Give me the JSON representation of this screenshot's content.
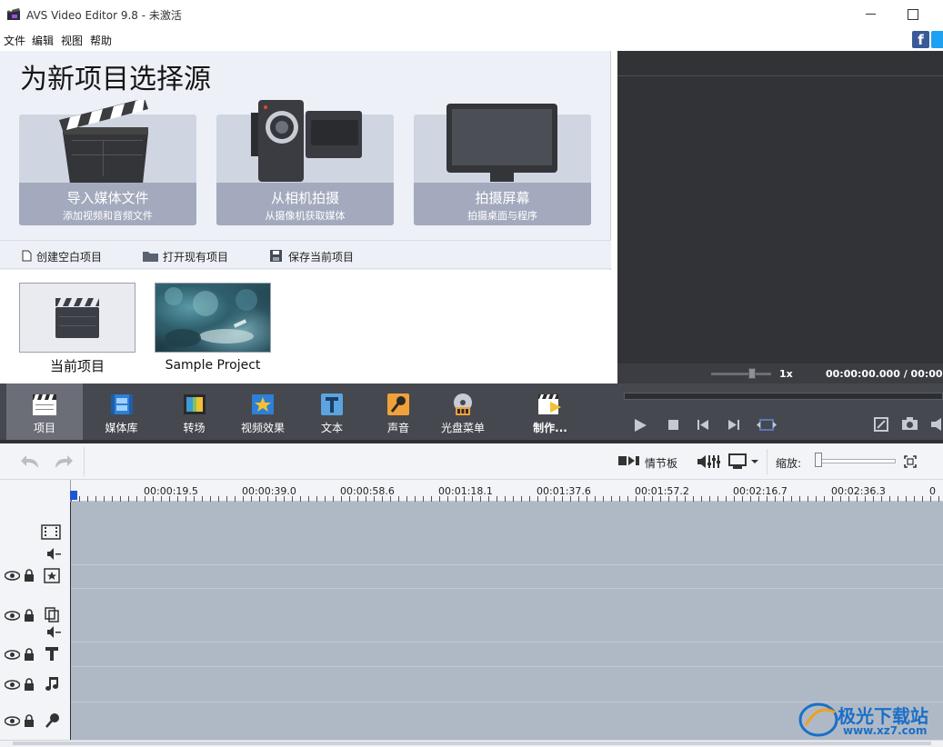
{
  "window": {
    "title": "AVS Video Editor 9.8 - 未激活"
  },
  "menu": {
    "items": [
      "文件",
      "编辑",
      "视图",
      "帮助"
    ]
  },
  "social": {
    "facebook_glyph": "f"
  },
  "source": {
    "title": "为新项目选择源",
    "cards": [
      {
        "title": "导入媒体文件",
        "subtitle": "添加视频和音频文件",
        "icon": "clapperboard-icon"
      },
      {
        "title": "从相机拍摄",
        "subtitle": "从摄像机获取媒体",
        "icon": "camcorder-icon"
      },
      {
        "title": "拍摄屏幕",
        "subtitle": "拍摄桌面与程序",
        "icon": "monitor-icon"
      }
    ]
  },
  "project_actions": {
    "create": "创建空白项目",
    "open": "打开现有项目",
    "save": "保存当前项目"
  },
  "recent": {
    "current": "当前项目",
    "sample": "Sample Project"
  },
  "preview": {
    "speed": "1x",
    "timecode": "00:00:00.000 / 00:00:0"
  },
  "toolbar": {
    "items": [
      {
        "label": "项目",
        "icon": "project-icon",
        "active": true
      },
      {
        "label": "媒体库",
        "icon": "media-library-icon"
      },
      {
        "label": "转场",
        "icon": "transitions-icon"
      },
      {
        "label": "视频效果",
        "icon": "video-effects-icon"
      },
      {
        "label": "文本",
        "icon": "text-icon"
      },
      {
        "label": "声音",
        "icon": "microphone-icon"
      },
      {
        "label": "光盘菜单",
        "icon": "disc-menu-icon"
      },
      {
        "label": "制作...",
        "icon": "produce-icon"
      }
    ]
  },
  "timeline_toolbar": {
    "storyboard": "情节板",
    "zoom": "缩放:"
  },
  "ruler": {
    "labels": [
      "00:00:19.5",
      "00:00:39.0",
      "00:00:58.6",
      "00:01:18.1",
      "00:01:37.6",
      "00:01:57.2",
      "00:02:16.7",
      "00:02:36.3",
      "0"
    ]
  },
  "colors": {
    "toolbar_bg": "#46484f",
    "timeline_bg": "#afb9c6",
    "preview_bg": "#323336",
    "accent_blue": "#1e56d6"
  },
  "watermark": {
    "name": "极光下载站",
    "url": "www.xz7.com"
  }
}
